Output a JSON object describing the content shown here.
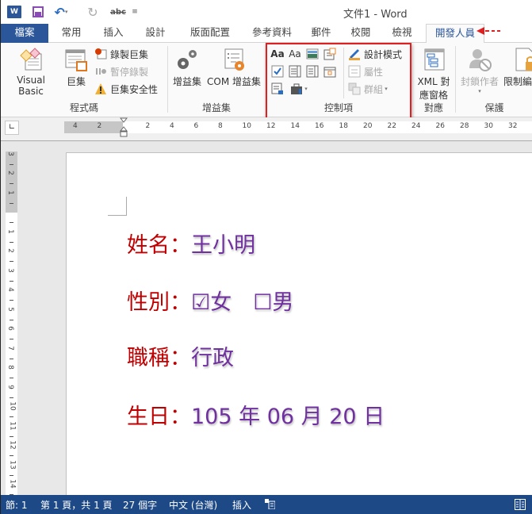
{
  "window": {
    "title": "文件1 - Word",
    "app_icon": "word-icon"
  },
  "quick_access": {
    "save": "save-icon",
    "undo": "undo-icon",
    "redo": "redo-icon",
    "spelling": "abc",
    "customize": "customize-qat-icon"
  },
  "tabs": [
    {
      "label": "檔案",
      "active": false,
      "file": true
    },
    {
      "label": "常用",
      "active": false
    },
    {
      "label": "插入",
      "active": false
    },
    {
      "label": "設計",
      "active": false
    },
    {
      "label": "版面配置",
      "active": false
    },
    {
      "label": "參考資料",
      "active": false
    },
    {
      "label": "郵件",
      "active": false
    },
    {
      "label": "校閱",
      "active": false
    },
    {
      "label": "檢視",
      "active": false
    },
    {
      "label": "開發人員",
      "active": true
    }
  ],
  "ribbon": {
    "code": {
      "label": "程式碼",
      "visual_basic": "Visual Basic",
      "macros": "巨集",
      "record_macro": "錄製巨集",
      "pause_recording": "暫停錄製",
      "macro_security": "巨集安全性"
    },
    "addins": {
      "label": "增益集",
      "addins_btn": "增益集",
      "com_addins": "COM 增益集"
    },
    "controls": {
      "label": "控制項",
      "design_mode": "設計模式",
      "properties": "屬性",
      "group": "群組",
      "rich_text": "Aa",
      "plain_text": "Aa"
    },
    "mapping": {
      "label": "對應",
      "xml_pane_line1": "XML 對",
      "xml_pane_line2": "應窗格"
    },
    "protect": {
      "label": "保護",
      "block_authors": "封鎖作者",
      "restrict_editing": "限制編輯"
    }
  },
  "ruler": {
    "left_numbers": [
      "4",
      "2"
    ],
    "right_numbers": [
      "2",
      "4",
      "6",
      "8",
      "10",
      "12",
      "14",
      "16",
      "18",
      "20",
      "22",
      "24",
      "26",
      "28",
      "30",
      "32"
    ],
    "vertical_top_numbers": [
      "3",
      "2",
      "1"
    ],
    "vertical_numbers": [
      "1",
      "2",
      "3",
      "4",
      "5",
      "6",
      "7",
      "8",
      "9",
      "10",
      "11",
      "12",
      "13",
      "14"
    ]
  },
  "document": {
    "lines": [
      {
        "label": "姓名：",
        "value": "王小明"
      },
      {
        "label": "性別：",
        "value": "☑女　☐男"
      },
      {
        "label": "職稱：",
        "value": "行政"
      },
      {
        "label": "生日：",
        "value": "105 年 06 月 20 日"
      }
    ]
  },
  "status": {
    "section": "節: 1",
    "page": "第 1 頁，共 1 頁",
    "words": "27 個字",
    "language": "中文 (台灣)",
    "mode": "插入",
    "macro_icon": "macro-record-icon",
    "read_mode_icon": "read-mode-icon"
  },
  "annotation": {
    "highlight_color": "#e02020",
    "arrow_target": "開發人員"
  }
}
